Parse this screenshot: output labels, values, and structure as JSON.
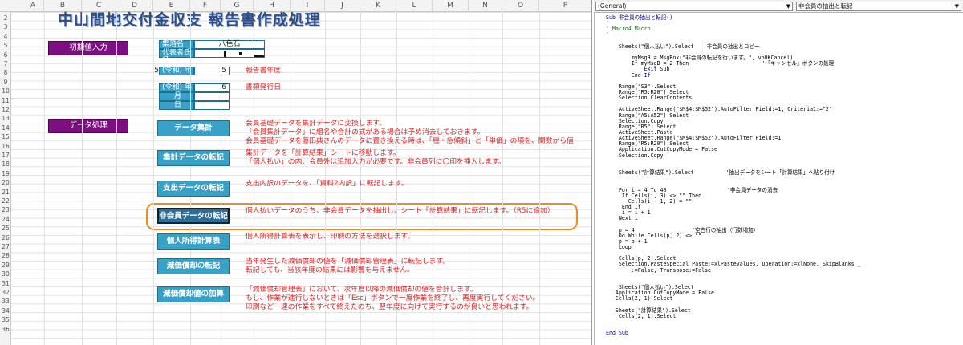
{
  "columns": [
    "A",
    "B",
    "C",
    "D",
    "E",
    "F",
    "G",
    "H",
    "I",
    "J",
    "K",
    "L",
    "M",
    "N",
    "O",
    "P"
  ],
  "rows": [
    "2",
    "3",
    "4",
    "5",
    "6",
    "7",
    "8",
    "9",
    "10",
    "11",
    "12",
    "13",
    "14",
    "15",
    "16",
    "17",
    "18",
    "19",
    "20",
    "21",
    "22",
    "23",
    "24",
    "25",
    "26",
    "27",
    "28",
    "29",
    "30",
    "31",
    "32",
    "33",
    "34",
    "35",
    "36"
  ],
  "title": "中山間地交付金収支 報告書作成処理",
  "left_buttons": {
    "initial": "初期値入力",
    "data": "データ処理"
  },
  "initial_fields": {
    "shuraku_label": "集落名",
    "shuraku_value": "八色石",
    "daihyo_label": "代表者氏名",
    "year_prefix": "5",
    "year_label": "(令和) 年",
    "year_value": "5",
    "year_note": "報告書年度",
    "issue_label": "(令和) 年",
    "issue_value": "6",
    "issue_note": "書類発行日",
    "month_label": "月",
    "day_label": "日"
  },
  "buttons": [
    {
      "label": "データ集計",
      "lines": [
        "会員基礎データを集計データに変換します。",
        "「会員集計データ」に組名や合計の式がある場合は予め消去しておきます。",
        "会員基礎データを藤田典さんのデータに置き換える時は、「種・急傾斜」と「単価」の項を、関数から値"
      ]
    },
    {
      "label": "集計データの転記",
      "lines": [
        "集計データを「計算結果」シートに移動します。",
        "「個人払い」の内、会員外は追加入力が必要です。非会員列に〇印を挿入します。"
      ]
    },
    {
      "label": "支出データの転記",
      "lines": [
        "支出内訳のデータを、「資料2内訳」に転記します。"
      ]
    },
    {
      "label": "非会員データの転記",
      "lines": [
        "個人払いデータのうち、非会員データを抽出し、シート「計算結果」に転記します。（R5に追加）"
      ]
    },
    {
      "label": "個人所得計算表",
      "lines": [
        "個人所得計算表を表示し、印刷の方法を選択します。"
      ]
    },
    {
      "label": "減価償却の転記",
      "lines": [
        "当年発生した減価償却の値を「減価償却管理表」に転記します。",
        "転記しても、当該年度の結果には影響を与えません。"
      ]
    },
    {
      "label": "減価償却値の加算",
      "lines": [
        "「減価償却管理表」において、次年度以降の減価償却の値を合計します。",
        "もし、作業が進行しないときは「Esc」ボタンで一度作業を終了し、再度実行してください。",
        "印刷など一連の作業をすべて終えたのち、翌年度に向けて実行するのが良いと思われます。"
      ]
    }
  ],
  "vbe": {
    "object_dropdown": "(General)",
    "proc_dropdown": "非会員の抽出と転記",
    "code": [
      {
        "t": "Sub 非会員の抽出と転記()",
        "k": "kw"
      },
      {
        "t": "'",
        "k": "cm"
      },
      {
        "t": "' Macro4 Macro",
        "k": "cm"
      },
      {
        "t": "'",
        "k": "cm"
      },
      {
        "t": "",
        "k": ""
      },
      {
        "t": "    Sheets(\"個人払い\").Select   '非会員の抽出とコピー",
        "k": ""
      },
      {
        "t": "",
        "k": ""
      },
      {
        "t": "        myMsgB = MsgBox(\"非会員の転記を行います。\", vbOKCancel)",
        "k": ""
      },
      {
        "t": "        If myMsgB = 2 Then                       '「キャンセル」ボタンの処理",
        "k": ""
      },
      {
        "t": "            Exit Sub",
        "k": "kw"
      },
      {
        "t": "        End If",
        "k": "kw"
      },
      {
        "t": "",
        "k": ""
      },
      {
        "t": "    Range(\"S3\").Select",
        "k": ""
      },
      {
        "t": "    Range(\"R5:R20\").Select",
        "k": ""
      },
      {
        "t": "    Selection.ClearContents",
        "k": ""
      },
      {
        "t": "",
        "k": ""
      },
      {
        "t": "    ActiveSheet.Range(\"$M$4:$M$52\").AutoFilter Field:=1, Criteria1:=\"2\"",
        "k": ""
      },
      {
        "t": "    Range(\"A5:A52\").Select",
        "k": ""
      },
      {
        "t": "    Selection.Copy",
        "k": ""
      },
      {
        "t": "    Range(\"R5\").Select",
        "k": ""
      },
      {
        "t": "    ActiveSheet.Paste",
        "k": ""
      },
      {
        "t": "    ActiveSheet.Range(\"$M$4:$M$52\").AutoFilter Field:=1",
        "k": ""
      },
      {
        "t": "    Range(\"R5:R20\").Select",
        "k": ""
      },
      {
        "t": "    Application.CutCopyMode = False",
        "k": ""
      },
      {
        "t": "    Selection.Copy",
        "k": ""
      },
      {
        "t": "",
        "k": ""
      },
      {
        "t": "",
        "k": ""
      },
      {
        "t": "    Sheets(\"計算結果\").Select          '抽出データをシート「計算結果」へ貼り付け",
        "k": ""
      },
      {
        "t": "",
        "k": ""
      },
      {
        "t": "",
        "k": ""
      },
      {
        "t": "    For i = 4 To 40                   '非会員データの消去",
        "k": ""
      },
      {
        "t": "     If Cells(i, 3) <> \"\" Then",
        "k": ""
      },
      {
        "t": "       Cells(i - 1, 2) = \"\"",
        "k": ""
      },
      {
        "t": "     End If",
        "k": ""
      },
      {
        "t": "     i = i + 1",
        "k": ""
      },
      {
        "t": "    Next i",
        "k": ""
      },
      {
        "t": "",
        "k": ""
      },
      {
        "t": "    p = 4                  '空白行の抽出（行数増加）",
        "k": ""
      },
      {
        "t": "    Do While Cells(p, 2) <> \"\"",
        "k": ""
      },
      {
        "t": "    p = p + 1",
        "k": ""
      },
      {
        "t": "    Loop",
        "k": ""
      },
      {
        "t": "",
        "k": ""
      },
      {
        "t": "    Cells(p, 2).Select",
        "k": ""
      },
      {
        "t": "    Selection.PasteSpecial Paste:=xlPasteValues, Operation:=xlNone, SkipBlanks _",
        "k": ""
      },
      {
        "t": "        :=False, Transpose:=False",
        "k": ""
      },
      {
        "t": "",
        "k": ""
      },
      {
        "t": "",
        "k": ""
      },
      {
        "t": "    Sheets(\"個人払い\").Select",
        "k": ""
      },
      {
        "t": "   Application.CutCopyMode = False",
        "k": ""
      },
      {
        "t": "   Cells(2, 1).Select",
        "k": ""
      },
      {
        "t": "",
        "k": ""
      },
      {
        "t": "   Sheets(\"計算結果\").Select",
        "k": ""
      },
      {
        "t": "    Cells(2, 1).Select",
        "k": ""
      },
      {
        "t": "",
        "k": ""
      },
      {
        "t": "",
        "k": ""
      },
      {
        "t": "End Sub",
        "k": "kw"
      }
    ]
  }
}
